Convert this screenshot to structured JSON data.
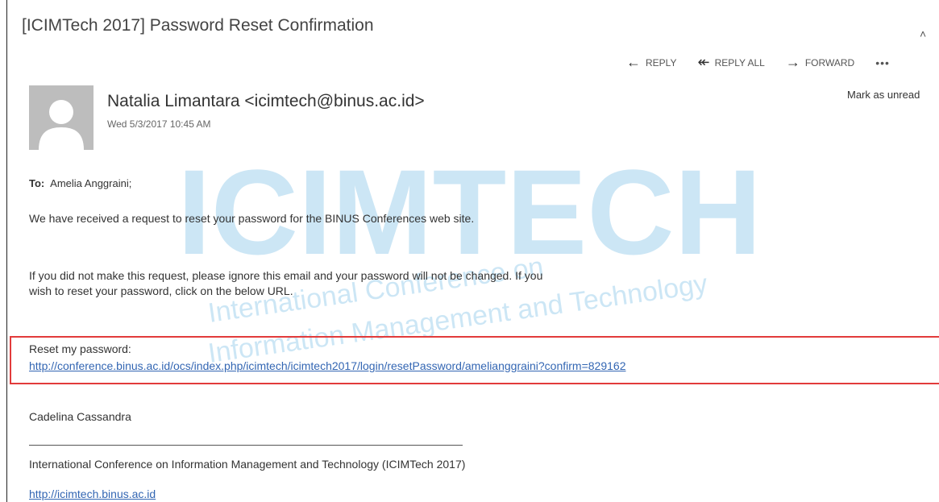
{
  "email": {
    "subject": "[ICIMTech 2017] Password Reset Confirmation",
    "actions": {
      "reply": "REPLY",
      "reply_all": "REPLY ALL",
      "forward": "FORWARD",
      "more": "•••"
    },
    "sender": "Natalia Limantara <icimtech@binus.ac.id>",
    "date": "Wed 5/3/2017 10:45 AM",
    "mark_unread": "Mark as unread",
    "to_label": "To:",
    "to_value": "Amelia Anggraini;",
    "body": {
      "para1": "We have received a request to reset your password for the BINUS Conferences web site.",
      "para2": "If you did not make this request, please ignore this email and your password will not be changed. If you wish to reset your password, click on the below URL.",
      "reset_label": "Reset my password:",
      "reset_link": "http://conference.binus.ac.id/ocs/index.php/icimtech/icimtech2017/login/resetPassword/amelianggraini?confirm=829162",
      "signer": "Cadelina Cassandra",
      "org": "International Conference on Information Management and Technology (ICIMTech 2017)",
      "site_link": "http://icimtech.binus.ac.id"
    },
    "watermark_text": {
      "logo": "ICIMTECH",
      "line1": "International Conference on",
      "line2": "Information Management and Technology"
    }
  },
  "colors": {
    "highlight_box": "#e23b3b",
    "link": "#3366b3",
    "watermark": "#4aa8dd"
  }
}
